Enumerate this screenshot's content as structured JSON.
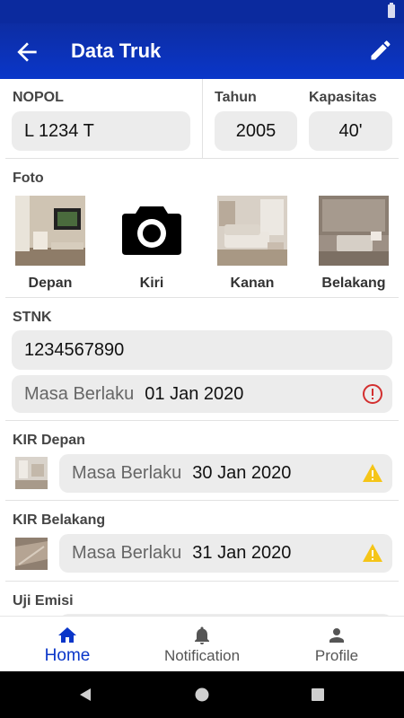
{
  "app_bar": {
    "title": "Data Truk",
    "back_icon": "arrow-back-icon",
    "edit_icon": "pencil-icon"
  },
  "truck": {
    "nopol": {
      "label": "NOPOL",
      "value": "L 1234 T"
    },
    "tahun": {
      "label": "Tahun",
      "value": "2005"
    },
    "kapasitas": {
      "label": "Kapasitas",
      "value": "40'"
    }
  },
  "foto": {
    "label": "Foto",
    "items": [
      {
        "caption": "Depan"
      },
      {
        "caption": "Kiri"
      },
      {
        "caption": "Kanan"
      },
      {
        "caption": "Belakang"
      }
    ]
  },
  "stnk": {
    "label": "STNK",
    "number": "1234567890",
    "validity_label": "Masa Berlaku",
    "validity_date": "01 Jan 2020",
    "status_icon": "error-circle-icon"
  },
  "kir_depan": {
    "label": "KIR Depan",
    "validity_label": "Masa Berlaku",
    "validity_date": "30 Jan 2020",
    "status_icon": "warning-icon"
  },
  "kir_belakang": {
    "label": "KIR Belakang",
    "validity_label": "Masa Berlaku",
    "validity_date": "31 Jan 2020",
    "status_icon": "warning-icon"
  },
  "uji_emisi": {
    "label": "Uji Emisi"
  },
  "bottom_nav": [
    {
      "label": "Home",
      "icon": "home-icon",
      "active": true
    },
    {
      "label": "Notification",
      "icon": "bell-icon",
      "active": false
    },
    {
      "label": "Profile",
      "icon": "person-icon",
      "active": false
    }
  ],
  "colors": {
    "primary": "#0a36c9",
    "error": "#d32f2f",
    "warning": "#f5c518",
    "field_bg": "#ececec"
  }
}
